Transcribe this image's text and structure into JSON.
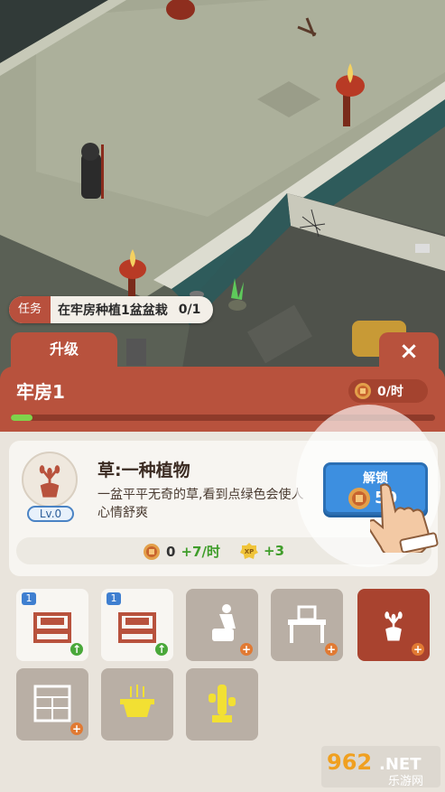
{
  "quest": {
    "tag": "任务",
    "text": "在牢房种植1盆盆栽",
    "count": "0/1"
  },
  "panel": {
    "tab_label": "升级",
    "close_label": "×",
    "room_title": "牢房1",
    "rate_text": "0/时",
    "progress": 0.05
  },
  "item": {
    "name": "草:一种植物",
    "description": "一盆平平无奇的草,看到点绿色会使人心情舒爽",
    "level": "Lv.0",
    "reward_coin_value": "0",
    "reward_coin_rate": "+7/时",
    "reward_xp": "+3"
  },
  "unlock": {
    "label": "解锁",
    "price": "50"
  },
  "slots": [
    {
      "name": "bed-slot-1",
      "icon": "bed-icon",
      "tag": "1",
      "state": "upgradable"
    },
    {
      "name": "bed-slot-2",
      "icon": "bed-icon",
      "tag": "1",
      "state": "upgradable"
    },
    {
      "name": "toilet-slot",
      "icon": "toilet-icon",
      "tag": "",
      "state": "locked"
    },
    {
      "name": "desk-slot",
      "icon": "desk-icon",
      "tag": "",
      "state": "locked"
    },
    {
      "name": "plant-slot",
      "icon": "plant-icon",
      "tag": "",
      "state": "selected"
    },
    {
      "name": "cabinet-slot",
      "icon": "cabinet-icon",
      "tag": "",
      "state": "locked"
    },
    {
      "name": "incense-slot",
      "icon": "incense-burner-icon",
      "tag": "",
      "state": "locked"
    },
    {
      "name": "cactus-slot",
      "icon": "cactus-icon",
      "tag": "",
      "state": "locked"
    }
  ],
  "watermark": {
    "text": "962.NET",
    "subtext": "乐游网"
  },
  "colors": {
    "panel": "#b8523d",
    "accent_green": "#7fd34b",
    "unlock_blue": "#3d8fe0",
    "coin": "#c8642e"
  }
}
